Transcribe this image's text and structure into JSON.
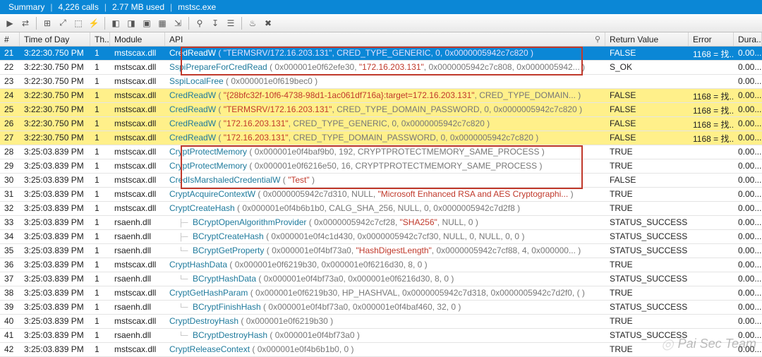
{
  "infobar": {
    "summary_label": "Summary",
    "call_count": "4,226 calls",
    "mem_used": "2.77 MB used",
    "process": "mstsc.exe"
  },
  "toolbar_icons": [
    "▶",
    "⇄",
    "⊞",
    "⤢",
    "⬚",
    "⚡",
    "◧",
    "◨",
    "▣",
    "▦",
    "⇲",
    "⚲",
    "↧",
    "☰",
    "♨",
    "✖"
  ],
  "columns": {
    "idx": "#",
    "time": "Time of Day",
    "th": "Th...",
    "mod": "Module",
    "api": "API",
    "api_find_glyph": "⚲",
    "ret": "Return Value",
    "err": "Error",
    "dur": "Dura..."
  },
  "rows": [
    {
      "n": "21",
      "time": "3:22:30.750 PM",
      "th": "1",
      "mod": "mstscax.dll",
      "style": "sel",
      "fn": "CredReadW",
      "args": [
        "\"TERMSRV/172.16.203.131\"",
        "CRED_TYPE_GENERIC",
        "0",
        "0x0000005942c7c820"
      ],
      "ret": "FALSE",
      "err": "1168 = 找...",
      "dur": "0.00..."
    },
    {
      "n": "22",
      "time": "3:22:30.750 PM",
      "th": "1",
      "mod": "mstscax.dll",
      "style": "white",
      "fn": "SspiPrepareForCredRead",
      "args": [
        "0x000001e0f62efe30",
        "§\"172.16.203.131\"",
        "0x0000005942c7c808",
        "0x0000005942..."
      ],
      "ret": "S_OK",
      "err": "",
      "dur": "0.00..."
    },
    {
      "n": "23",
      "time": "3:22:30.750 PM",
      "th": "1",
      "mod": "mstscax.dll",
      "style": "white",
      "fn": "SspiLocalFree",
      "args": [
        "0x000001e0f619bec0"
      ],
      "ret": "",
      "err": "",
      "dur": "0.00..."
    },
    {
      "n": "24",
      "time": "3:22:30.750 PM",
      "th": "1",
      "mod": "mstscax.dll",
      "style": "yellow",
      "fn": "CredReadW",
      "args": [
        "§\"{28bfc32f-10f6-4738-98d1-1ac061df716a}:target=172.16.203.131\"",
        "CRED_TYPE_DOMAIN..."
      ],
      "ret": "FALSE",
      "err": "1168 = 找...",
      "dur": "0.00..."
    },
    {
      "n": "25",
      "time": "3:22:30.750 PM",
      "th": "1",
      "mod": "mstscax.dll",
      "style": "yellow",
      "fn": "CredReadW",
      "args": [
        "§\"TERMSRV/172.16.203.131\"",
        "CRED_TYPE_DOMAIN_PASSWORD",
        "0",
        "0x0000005942c7c820"
      ],
      "ret": "FALSE",
      "err": "1168 = 找...",
      "dur": "0.00..."
    },
    {
      "n": "26",
      "time": "3:22:30.750 PM",
      "th": "1",
      "mod": "mstscax.dll",
      "style": "yellow",
      "fn": "CredReadW",
      "args": [
        "§\"172.16.203.131\"",
        "CRED_TYPE_GENERIC",
        "0",
        "0x0000005942c7c820"
      ],
      "ret": "FALSE",
      "err": "1168 = 找...",
      "dur": "0.00..."
    },
    {
      "n": "27",
      "time": "3:22:30.750 PM",
      "th": "1",
      "mod": "mstscax.dll",
      "style": "yellow",
      "fn": "CredReadW",
      "args": [
        "§\"172.16.203.131\"",
        "CRED_TYPE_DOMAIN_PASSWORD",
        "0",
        "0x0000005942c7c820"
      ],
      "ret": "FALSE",
      "err": "1168 = 找...",
      "dur": "0.00..."
    },
    {
      "n": "28",
      "time": "3:25:03.839 PM",
      "th": "1",
      "mod": "mstscax.dll",
      "style": "white",
      "fn": "CryptProtectMemory",
      "args": [
        "0x000001e0f4baf9b0",
        "192",
        "CRYPTPROTECTMEMORY_SAME_PROCESS"
      ],
      "ret": "TRUE",
      "err": "",
      "dur": "0.00..."
    },
    {
      "n": "29",
      "time": "3:25:03.839 PM",
      "th": "1",
      "mod": "mstscax.dll",
      "style": "white",
      "fn": "CryptProtectMemory",
      "args": [
        "0x000001e0f6216e50",
        "16",
        "CRYPTPROTECTMEMORY_SAME_PROCESS"
      ],
      "ret": "TRUE",
      "err": "",
      "dur": "0.00..."
    },
    {
      "n": "30",
      "time": "3:25:03.839 PM",
      "th": "1",
      "mod": "mstscax.dll",
      "style": "white",
      "fn": "CredIsMarshaledCredentialW",
      "args": [
        "§\"Test\""
      ],
      "ret": "FALSE",
      "err": "",
      "dur": "0.00..."
    },
    {
      "n": "31",
      "time": "3:25:03.839 PM",
      "th": "1",
      "mod": "mstscax.dll",
      "style": "white",
      "fn": "CryptAcquireContextW",
      "args": [
        "0x0000005942c7d310",
        "NULL",
        "§\"Microsoft Enhanced RSA and AES Cryptographi..."
      ],
      "ret": "TRUE",
      "err": "",
      "dur": "0.00..."
    },
    {
      "n": "32",
      "time": "3:25:03.839 PM",
      "th": "1",
      "mod": "mstscax.dll",
      "style": "white",
      "fn": "CryptCreateHash",
      "args": [
        "0x000001e0f4b6b1b0",
        "CALG_SHA_256",
        "NULL",
        "0",
        "0x0000005942c7d2f8"
      ],
      "ret": "TRUE",
      "err": "",
      "dur": "0.00..."
    },
    {
      "n": "33",
      "time": "3:25:03.839 PM",
      "th": "1",
      "mod": "rsaenh.dll",
      "style": "white",
      "indent": "  ├─",
      "fn": "BCryptOpenAlgorithmProvider",
      "args": [
        "0x0000005942c7cf28",
        "§\"SHA256\"",
        "NULL",
        "0"
      ],
      "ret": "STATUS_SUCCESS",
      "err": "",
      "dur": "0.00..."
    },
    {
      "n": "34",
      "time": "3:25:03.839 PM",
      "th": "1",
      "mod": "rsaenh.dll",
      "style": "white",
      "indent": "  ├─",
      "fn": "BCryptCreateHash",
      "args": [
        "0x000001e0f4c1d430",
        "0x0000005942c7cf30",
        "NULL",
        "0",
        "NULL",
        "0",
        "0"
      ],
      "ret": "STATUS_SUCCESS",
      "err": "",
      "dur": "0.00..."
    },
    {
      "n": "35",
      "time": "3:25:03.839 PM",
      "th": "1",
      "mod": "rsaenh.dll",
      "style": "white",
      "indent": "  └─",
      "fn": "BCryptGetProperty",
      "args": [
        "0x000001e0f4bf73a0",
        "§\"HashDigestLength\"",
        "0x0000005942c7cf88",
        "4",
        "0x000000..."
      ],
      "ret": "STATUS_SUCCESS",
      "err": "",
      "dur": "0.00..."
    },
    {
      "n": "36",
      "time": "3:25:03.839 PM",
      "th": "1",
      "mod": "mstscax.dll",
      "style": "white",
      "fn": "CryptHashData",
      "args": [
        "0x000001e0f6219b30",
        "0x000001e0f6216d30",
        "8",
        "0"
      ],
      "ret": "TRUE",
      "err": "",
      "dur": "0.00..."
    },
    {
      "n": "37",
      "time": "3:25:03.839 PM",
      "th": "1",
      "mod": "rsaenh.dll",
      "style": "white",
      "indent": "  └─",
      "fn": "BCryptHashData",
      "args": [
        "0x000001e0f4bf73a0",
        "0x000001e0f6216d30",
        "8",
        "0"
      ],
      "ret": "STATUS_SUCCESS",
      "err": "",
      "dur": "0.00..."
    },
    {
      "n": "38",
      "time": "3:25:03.839 PM",
      "th": "1",
      "mod": "mstscax.dll",
      "style": "white",
      "fn": "CryptGetHashParam",
      "args": [
        "0x000001e0f6219b30",
        "HP_HASHVAL",
        "0x0000005942c7d318",
        "0x0000005942c7d2f0",
        "("
      ],
      "ret": "TRUE",
      "err": "",
      "dur": "0.00..."
    },
    {
      "n": "39",
      "time": "3:25:03.839 PM",
      "th": "1",
      "mod": "rsaenh.dll",
      "style": "white",
      "indent": "  └─",
      "fn": "BCryptFinishHash",
      "args": [
        "0x000001e0f4bf73a0",
        "0x000001e0f4baf460",
        "32",
        "0"
      ],
      "ret": "STATUS_SUCCESS",
      "err": "",
      "dur": "0.00..."
    },
    {
      "n": "40",
      "time": "3:25:03.839 PM",
      "th": "1",
      "mod": "mstscax.dll",
      "style": "white",
      "fn": "CryptDestroyHash",
      "args": [
        "0x000001e0f6219b30"
      ],
      "ret": "TRUE",
      "err": "",
      "dur": "0.00..."
    },
    {
      "n": "41",
      "time": "3:25:03.839 PM",
      "th": "1",
      "mod": "rsaenh.dll",
      "style": "white",
      "indent": "  └─",
      "fn": "BCryptDestroyHash",
      "args": [
        "0x000001e0f4bf73a0"
      ],
      "ret": "STATUS_SUCCESS",
      "err": "",
      "dur": "0.00..."
    },
    {
      "n": "42",
      "time": "3:25:03.839 PM",
      "th": "1",
      "mod": "mstscax.dll",
      "style": "white",
      "fn": "CryptReleaseContext",
      "args": [
        "0x000001e0f4b6b1b0",
        "0"
      ],
      "ret": "TRUE",
      "err": "",
      "dur": "0.00..."
    }
  ],
  "watermark": {
    "text": "Pai Sec Team"
  }
}
